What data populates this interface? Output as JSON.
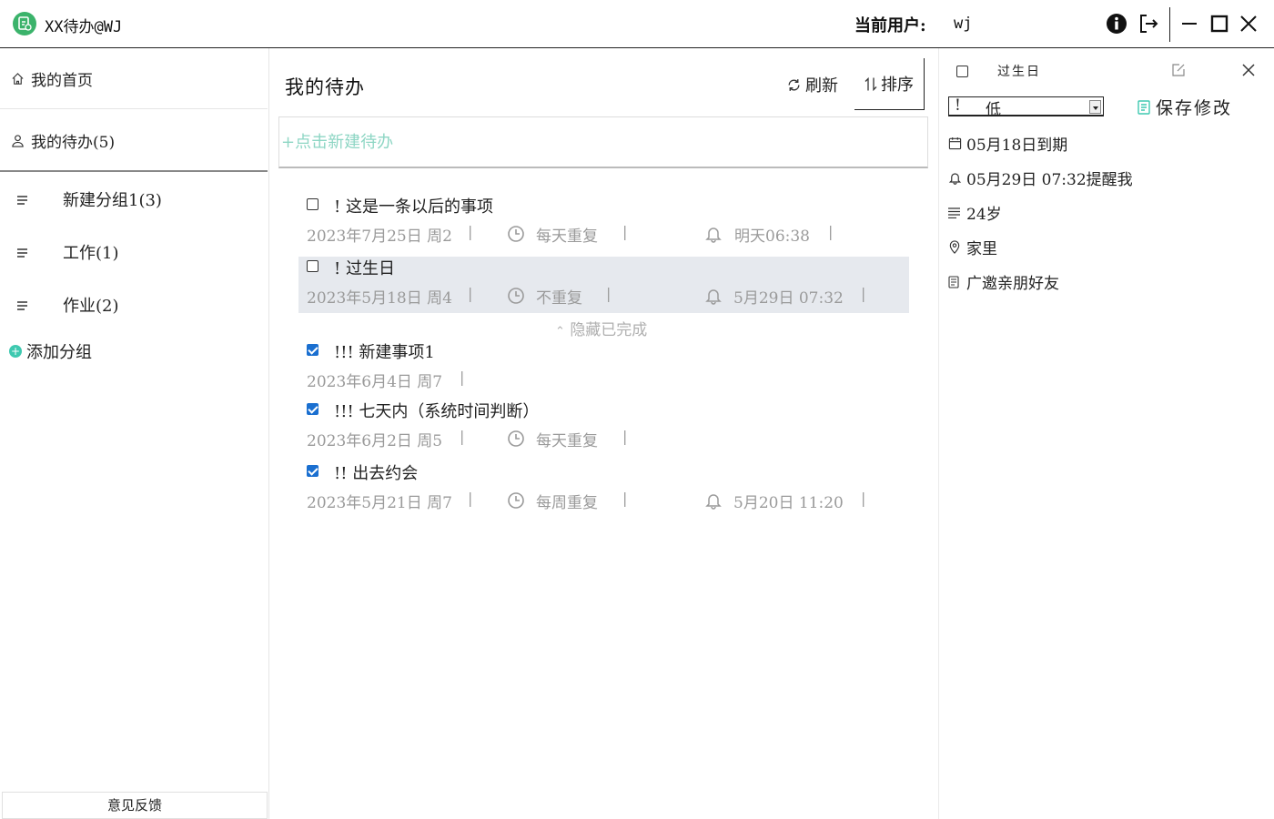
{
  "titlebar": {
    "app_title": "XX待办@WJ",
    "current_user_label": "当前用户:",
    "current_user": "wj"
  },
  "sidebar": {
    "home_label": "我的首页",
    "todo_label": "我的待办(5)",
    "groups": [
      {
        "label": "新建分组1(3)"
      },
      {
        "label": "工作(1)"
      },
      {
        "label": "作业(2)"
      }
    ],
    "add_group_label": "添加分组",
    "feedback_label": "意见反馈"
  },
  "main": {
    "title": "我的待办",
    "refresh_label": "刷新",
    "sort_label": "排序",
    "new_todo_placeholder": "+点击新建待办",
    "hide_completed_label": "隐藏已完成",
    "tasks": [
      {
        "title": "! 这是一条以后的事项",
        "date": "2023年7月25日 周2",
        "repeat": "每天重复",
        "remind": "明天06:38",
        "done": false
      },
      {
        "title": "! 过生日",
        "date": "2023年5月18日 周4",
        "repeat": "不重复",
        "remind": "5月29日 07:32",
        "done": false,
        "selected": true
      },
      {
        "title": "!!! 新建事项1",
        "date": "2023年6月4日 周7",
        "repeat": "",
        "remind": "",
        "done": true
      },
      {
        "title": "!!! 七天内（系统时间判断）",
        "date": "2023年6月2日 周5",
        "repeat": "每天重复",
        "remind": "",
        "done": true
      },
      {
        "title": "!! 出去约会",
        "date": "2023年5月21日 周7",
        "repeat": "每周重复",
        "remind": "5月20日 11:20",
        "done": true
      }
    ]
  },
  "detail": {
    "title": "过生日",
    "priority_mark": "!",
    "priority_value": "低",
    "save_label": "保存修改",
    "due": "05月18日到期",
    "remind": "05月29日 07:32提醒我",
    "note": "24岁",
    "location": "家里",
    "description": "广邀亲朋好友"
  },
  "colors": {
    "accent": "#3ec9b0",
    "logo": "#3bb36b",
    "checkbox_done": "#1a6fd0",
    "selected_row": "#e6e9ee",
    "placeholder": "#8ed6c4"
  }
}
